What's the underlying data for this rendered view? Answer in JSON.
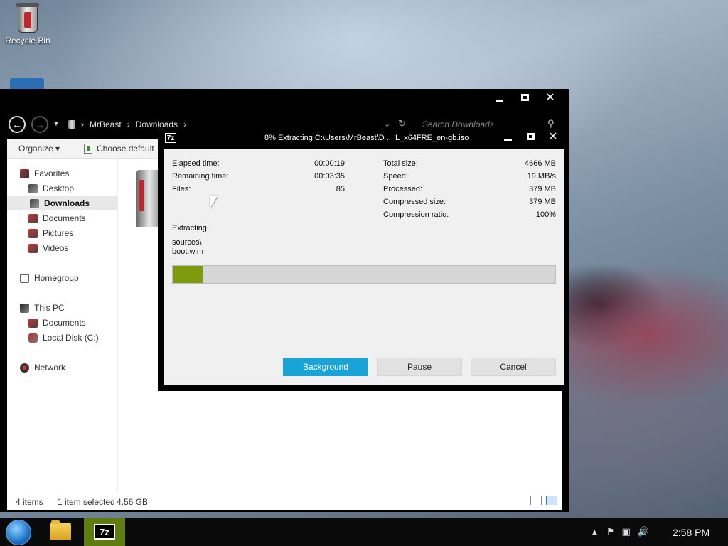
{
  "desktop": {
    "recycle_bin_label": "Recycle Bin"
  },
  "explorer": {
    "nav": {
      "back_glyph": "←",
      "forward_glyph": "→",
      "breadcrumb": [
        "MrBeast",
        "Downloads"
      ],
      "search_placeholder": "Search Downloads"
    },
    "toolbar": {
      "organize_label": "Organize ▾",
      "choose_default_label": "Choose default"
    },
    "navpane": {
      "favorites": "Favorites",
      "desktop": "Desktop",
      "downloads": "Downloads",
      "documents": "Documents",
      "pictures": "Pictures",
      "videos": "Videos",
      "homegroup": "Homegroup",
      "this_pc": "This PC",
      "pc_documents": "Documents",
      "local_disk": "Local Disk (C:)",
      "network": "Network"
    },
    "status": {
      "items": "4 items",
      "selected": "1 item selected",
      "size": "4.56 GB"
    }
  },
  "sevenzip": {
    "logo": "7z",
    "title": "8% Extracting C:\\Users\\MrBeast\\D ... L_x64FRE_en-gb.iso",
    "left_stats": [
      {
        "label": "Elapsed time:",
        "value": "00:00:19"
      },
      {
        "label": "Remaining time:",
        "value": "00:03:35"
      },
      {
        "label": "Files:",
        "value": "85"
      }
    ],
    "right_stats": [
      {
        "label": "Total size:",
        "value": "4666 MB"
      },
      {
        "label": "Speed:",
        "value": "19 MB/s"
      },
      {
        "label": "Processed:",
        "value": "379 MB"
      },
      {
        "label": "Compressed size:",
        "value": "379 MB"
      },
      {
        "label": "Compression ratio:",
        "value": "100%"
      }
    ],
    "operation_label": "Extracting",
    "current_path": "sources\\",
    "current_file": "boot.wim",
    "progress_percent": 8,
    "buttons": {
      "background": "Background",
      "pause": "Pause",
      "cancel": "Cancel"
    }
  },
  "taskbar": {
    "seven_zip_logo": "7z",
    "clock": "2:58 PM"
  },
  "colors": {
    "progress_fill": "#7e9b0e",
    "primary_button": "#1aa3d7",
    "taskbar_active": "#5f7d0f"
  }
}
